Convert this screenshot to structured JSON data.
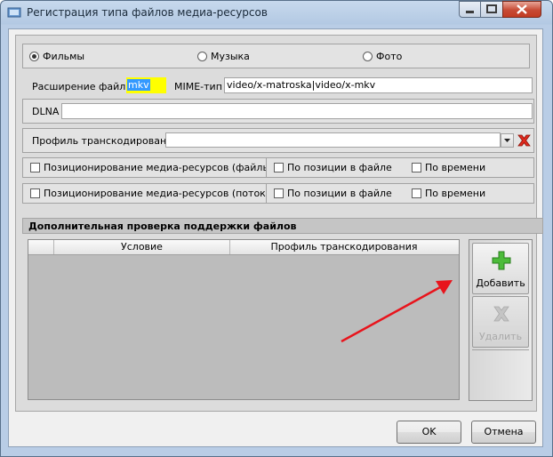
{
  "window": {
    "title": "Регистрация типа файлов медиа-ресурсов"
  },
  "media_type": {
    "options": [
      "Фильмы",
      "Музыка",
      "Фото"
    ],
    "selected": "Фильмы"
  },
  "extension": {
    "label": "Расширение файла",
    "value": "mkv"
  },
  "mime": {
    "label": "MIME-тип",
    "value": "video/x-matroska|video/x-mkv"
  },
  "dlna": {
    "label": "DLNA",
    "value": ""
  },
  "transcode": {
    "label": "Профиль транскодирования",
    "value": ""
  },
  "positioning": {
    "files": {
      "label": "Позиционирование медиа-ресурсов (файлы)",
      "checked": false
    },
    "stream": {
      "label": "Позиционирование медиа-ресурсов (поток)",
      "checked": false
    },
    "by_position": "По позиции в файле",
    "by_time": "По времени"
  },
  "extra_check": {
    "title": "Дополнительная проверка поддержки файлов",
    "columns": [
      "Условие",
      "Профиль транскодирования"
    ],
    "rows": [],
    "add_label": "Добавить",
    "delete_label": "Удалить"
  },
  "buttons": {
    "ok": "OK",
    "cancel": "Отмена"
  },
  "colors": {
    "accent_selection": "#3399ff",
    "highlight": "#ffff00",
    "arrow": "#e8141c"
  }
}
